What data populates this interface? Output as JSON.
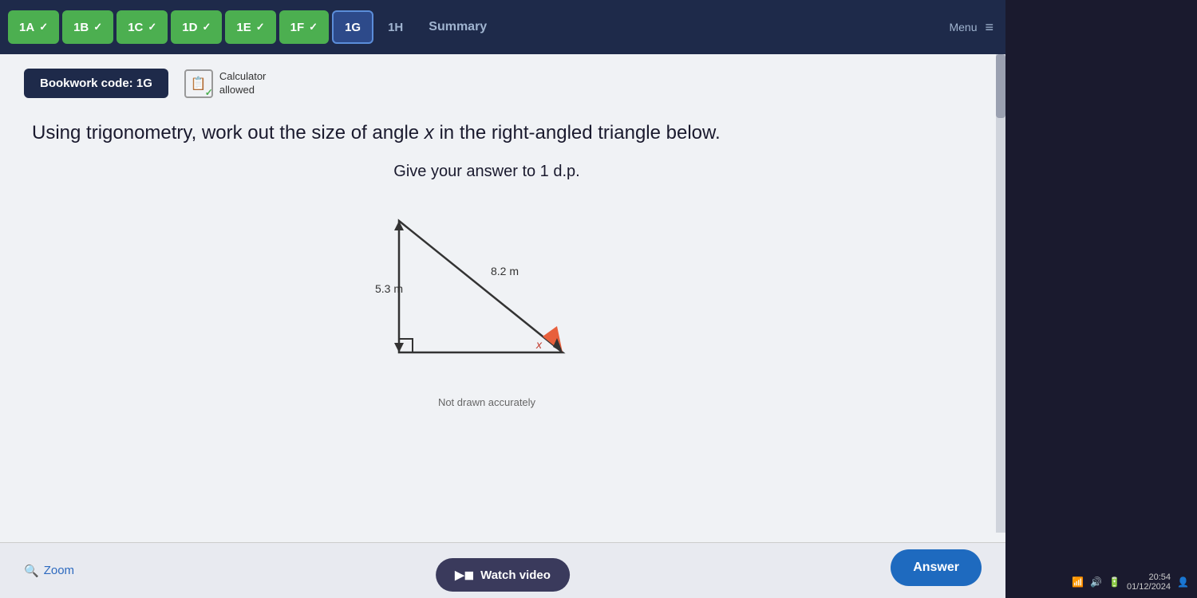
{
  "nav": {
    "tabs": [
      {
        "id": "1A",
        "label": "1A",
        "state": "completed"
      },
      {
        "id": "1B",
        "label": "1B",
        "state": "completed"
      },
      {
        "id": "1C",
        "label": "1C",
        "state": "completed"
      },
      {
        "id": "1D",
        "label": "1D",
        "state": "completed"
      },
      {
        "id": "1E",
        "label": "1E",
        "state": "completed"
      },
      {
        "id": "1F",
        "label": "1F",
        "state": "completed"
      },
      {
        "id": "1G",
        "label": "1G",
        "state": "active"
      },
      {
        "id": "1H",
        "label": "1H",
        "state": "inactive"
      },
      {
        "id": "summary",
        "label": "Summary",
        "state": "summary"
      }
    ],
    "menu_label": "Menu"
  },
  "bookwork": {
    "label": "Bookwork code: 1G"
  },
  "calculator": {
    "label": "Calculator\nallowed"
  },
  "question": {
    "main_text": "Using trigonometry, work out the size of angle x in the right-angled triangle below.",
    "sub_text": "Give your answer to 1 d.p.",
    "not_drawn": "Not drawn accurately"
  },
  "triangle": {
    "side_hypotenuse": "8.2 m",
    "side_vertical": "5.3 m",
    "angle_label": "x"
  },
  "buttons": {
    "zoom": "Zoom",
    "watch_video": "Watch video",
    "answer": "Answer"
  },
  "system": {
    "time": "20:54",
    "date": "01/12/2024"
  },
  "icons": {
    "zoom": "🔍",
    "video": "▶",
    "calculator": "📋",
    "check": "✓"
  }
}
